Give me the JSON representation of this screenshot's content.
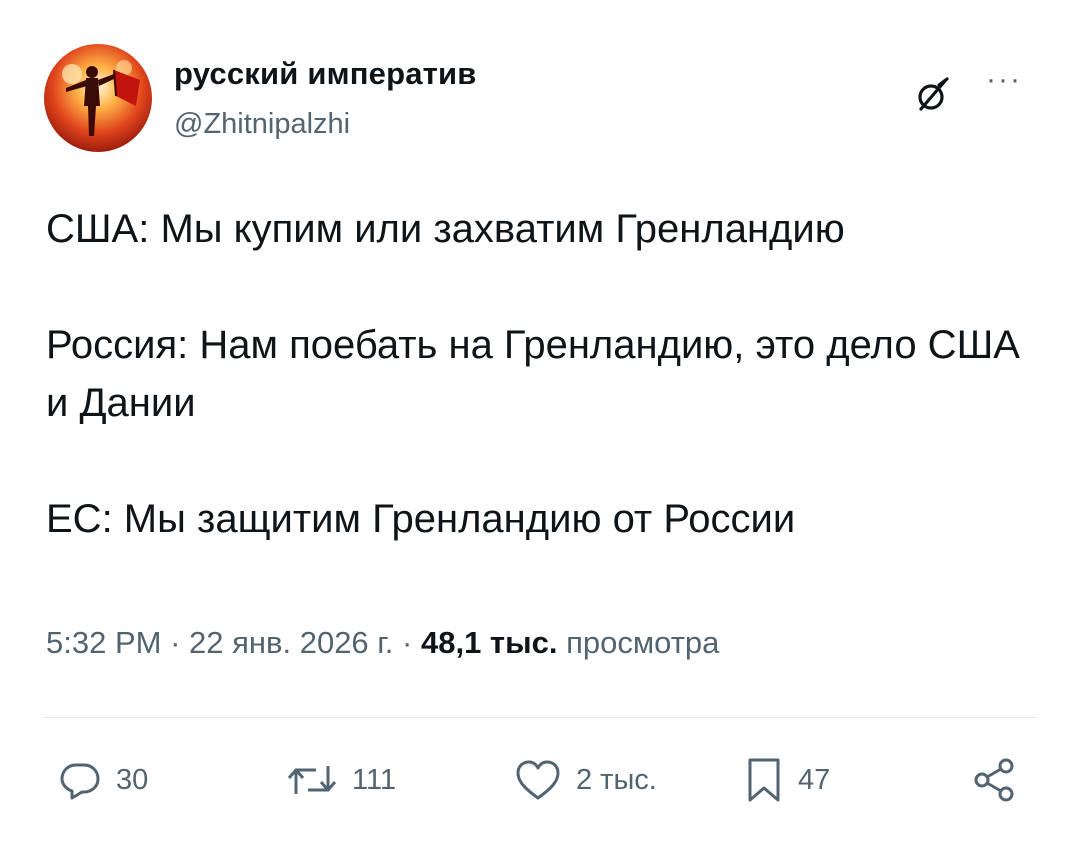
{
  "author": {
    "display_name": "русский императив",
    "handle": "@Zhitnipalzhi",
    "avatar_icon": "avatar-image"
  },
  "header_icons": {
    "grok": "grok-icon",
    "more": "more-icon",
    "more_glyph": "···"
  },
  "tweet": {
    "text": "США: Мы купим или захватим Гренландию\n\nРоссия: Нам поебать на Гренландию, это дело США и Дании\n\nЕС: Мы защитим Гренландию от России"
  },
  "meta": {
    "time": "5:32 PM",
    "sep1": " · ",
    "date": "22 янв. 2026 г.",
    "sep2": " · ",
    "views_count": "48,1 тыс.",
    "views_label": "просмотра"
  },
  "actions": {
    "replies": "30",
    "retweets": "111",
    "likes": "2 тыс.",
    "bookmarks": "47"
  },
  "colors": {
    "text": "#0f1419",
    "secondary": "#536471",
    "divider": "#e6e9ea",
    "background": "#ffffff"
  }
}
